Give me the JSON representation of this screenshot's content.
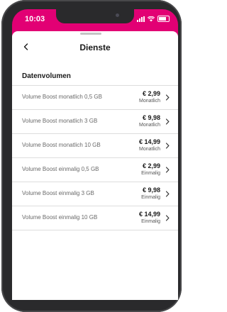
{
  "status_bar": {
    "time": "10:03"
  },
  "header": {
    "title": "Dienste"
  },
  "section": {
    "title": "Datenvolumen"
  },
  "items": [
    {
      "label": "Volume Boost monatlich 0,5 GB",
      "price": "€ 2,99",
      "period": "Monatlich"
    },
    {
      "label": "Volume Boost monatlich 3 GB",
      "price": "€ 9,98",
      "period": "Monatlich"
    },
    {
      "label": "Volume Boost monatlich 10 GB",
      "price": "€ 14,99",
      "period": "Monatlich"
    },
    {
      "label": "Volume Boost einmalig 0,5 GB",
      "price": "€ 2,99",
      "period": "Einmalig"
    },
    {
      "label": "Volume Boost einmalig 3 GB",
      "price": "€ 9,98",
      "period": "Einmalig"
    },
    {
      "label": "Volume Boost einmalig 10 GB",
      "price": "€ 14,99",
      "period": "Einmalig"
    }
  ],
  "colors": {
    "brand": "#e20074",
    "text": "#1a1a1a",
    "muted": "#6a6a6a",
    "divider": "#dddddd"
  }
}
